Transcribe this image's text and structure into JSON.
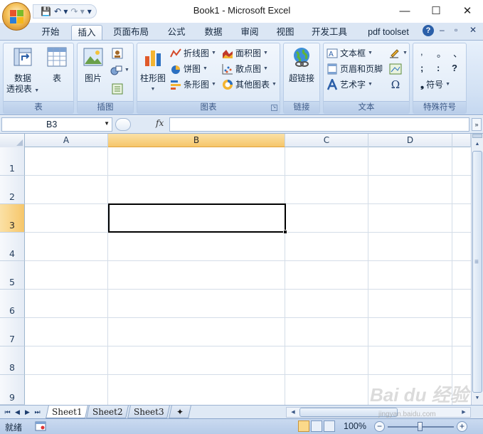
{
  "window": {
    "title": "Book1 - Microsoft Excel",
    "minimize": "—",
    "maximize": "☐",
    "close": "✕"
  },
  "qat": {
    "save": "💾",
    "undo": "↶ ▾",
    "redo": "↷ ▾",
    "customize": "▾"
  },
  "tabs": [
    {
      "label": "开始"
    },
    {
      "label": "插入"
    },
    {
      "label": "页面布局"
    },
    {
      "label": "公式"
    },
    {
      "label": "数据"
    },
    {
      "label": "审阅"
    },
    {
      "label": "视图"
    },
    {
      "label": "开发工具"
    },
    {
      "label": "pdf toolset"
    }
  ],
  "active_tab": "插入",
  "ribbon_right": {
    "help": "?",
    "min": "–",
    "restore": "▫",
    "close": "✕"
  },
  "ribbon": {
    "groups": [
      {
        "label": "表",
        "buttons": [
          "数据\n透视表",
          "表"
        ],
        "pivot_line1": "数据",
        "pivot_line2": "透视表",
        "table": "表"
      },
      {
        "label": "插图",
        "picture": "图片"
      },
      {
        "label": "图表",
        "column": "柱形图",
        "line": "折线图",
        "pie": "饼图",
        "bar": "条形图",
        "area": "面积图",
        "scatter": "散点图",
        "other": "其他图表"
      },
      {
        "label": "链接",
        "hyperlink": "超链接"
      },
      {
        "label": "文本",
        "textbox": "文本框",
        "header_footer": "页眉和页脚",
        "wordart": "艺术字"
      },
      {
        "label": "特殊符号",
        "symbol": "符号",
        "sym1": ",",
        "sym2": "。",
        "sym3": "、",
        "sym4": ";",
        "sym5": ":",
        "sym6": "?",
        "omega": "Ω"
      }
    ]
  },
  "formula_bar": {
    "name_box": "B3",
    "fx": "fx",
    "value": ""
  },
  "grid": {
    "columns": [
      "A",
      "B",
      "C",
      "D"
    ],
    "rows": [
      "1",
      "2",
      "3",
      "4",
      "5",
      "6",
      "7",
      "8",
      "9"
    ],
    "selected_column": "B",
    "selected_row": "3"
  },
  "sheets": [
    "Sheet1",
    "Sheet2",
    "Sheet3"
  ],
  "active_sheet": "Sheet1",
  "status": {
    "ready": "就绪",
    "zoom": "100%"
  },
  "watermark": {
    "main": "Bai du 经验",
    "sub": "jingyan.baidu.com"
  },
  "colors": {
    "accent": "#f6c66a",
    "ribbon": "#d2e1f4",
    "frame": "#9db4d3"
  }
}
